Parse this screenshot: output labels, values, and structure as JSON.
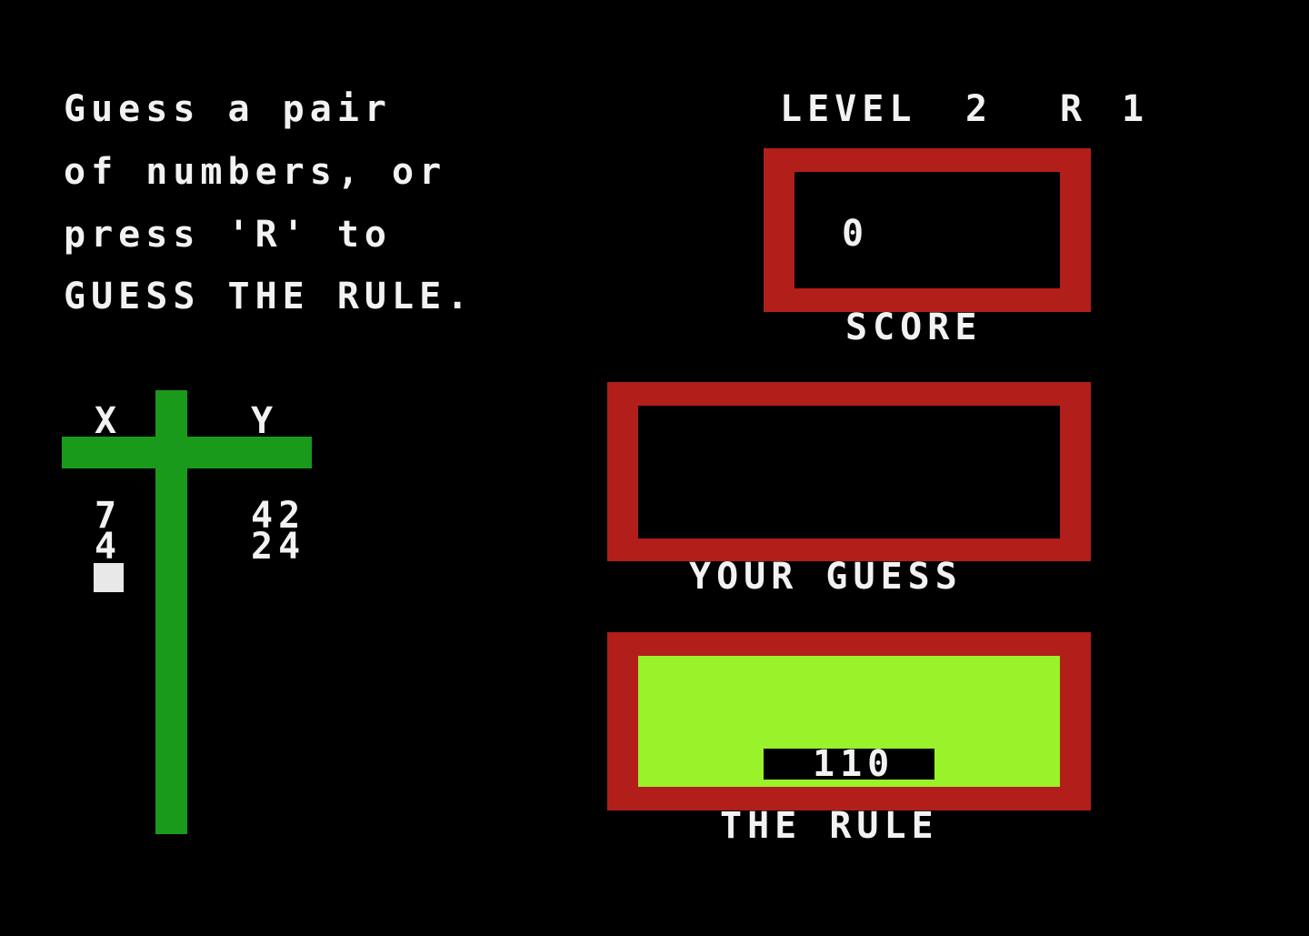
{
  "instructions": {
    "lines": [
      "Guess a pair",
      "of numbers, or",
      "press 'R' to",
      "GUESS THE RULE."
    ]
  },
  "status": {
    "level_label": "LEVEL",
    "level": "2",
    "round_label": "R",
    "round": "1"
  },
  "score": {
    "value": "0",
    "label": "SCORE"
  },
  "guess": {
    "value": "",
    "label": "YOUR GUESS"
  },
  "rule": {
    "value": "110",
    "label": "THE RULE"
  },
  "table": {
    "header_x": "X",
    "header_y": "Y",
    "rows": [
      {
        "x": "7",
        "y": "42"
      },
      {
        "x": "4",
        "y": "24"
      }
    ]
  },
  "colors": {
    "frame": "#b21e1a",
    "table_lines": "#1a9a1a",
    "rule_fill": "#99f22a",
    "text": "#f2f2f2",
    "background": "#000000"
  }
}
